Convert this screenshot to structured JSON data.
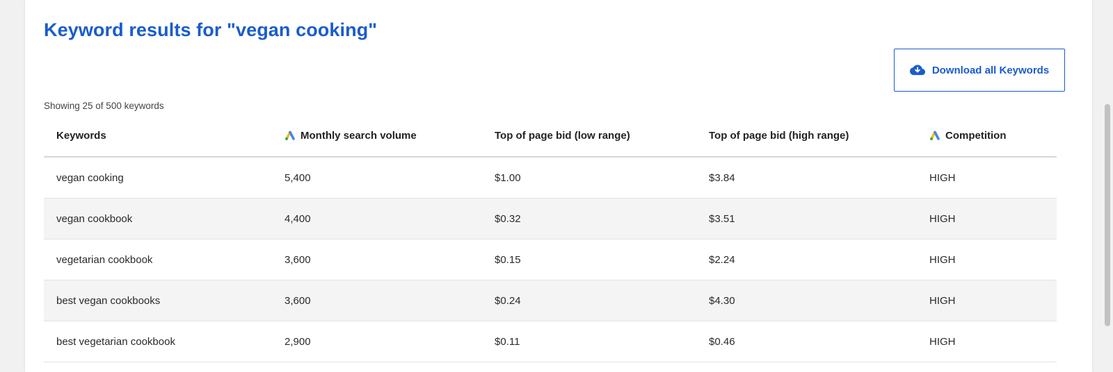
{
  "header": {
    "title": "Keyword results for \"vegan cooking\"",
    "download_label": "Download all Keywords",
    "download_icon": "cloud-download-icon",
    "showing_text": "Showing 25 of 500 keywords"
  },
  "colors": {
    "accent": "#1a5ccc",
    "row_alt": "#f4f4f4",
    "google_ads_yellow": "#fbbc04",
    "google_ads_blue": "#4285f4",
    "google_ads_green": "#34a853"
  },
  "table": {
    "columns": [
      {
        "label": "Keywords",
        "icon": ""
      },
      {
        "label": "Monthly search volume",
        "icon": "google-ads-icon"
      },
      {
        "label": "Top of page bid (low range)",
        "icon": ""
      },
      {
        "label": "Top of page bid (high range)",
        "icon": ""
      },
      {
        "label": "Competition",
        "icon": "google-ads-icon"
      }
    ],
    "rows": [
      {
        "keyword": "vegan cooking",
        "volume": "5,400",
        "low_bid": "$1.00",
        "high_bid": "$3.84",
        "competition": "HIGH"
      },
      {
        "keyword": "vegan cookbook",
        "volume": "4,400",
        "low_bid": "$0.32",
        "high_bid": "$3.51",
        "competition": "HIGH"
      },
      {
        "keyword": "vegetarian cookbook",
        "volume": "3,600",
        "low_bid": "$0.15",
        "high_bid": "$2.24",
        "competition": "HIGH"
      },
      {
        "keyword": "best vegan cookbooks",
        "volume": "3,600",
        "low_bid": "$0.24",
        "high_bid": "$4.30",
        "competition": "HIGH"
      },
      {
        "keyword": "best vegetarian cookbook",
        "volume": "2,900",
        "low_bid": "$0.11",
        "high_bid": "$0.46",
        "competition": "HIGH"
      }
    ]
  }
}
